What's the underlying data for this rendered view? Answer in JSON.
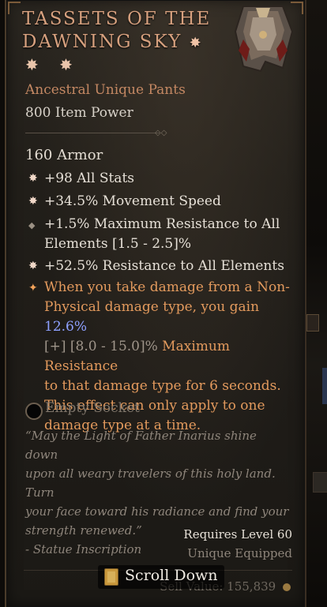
{
  "item": {
    "name": "Tassets of the Dawning Sky",
    "stars": "✸ ✸",
    "title_star": "✸",
    "type": "Ancestral Unique Pants",
    "item_power": "800 Item Power",
    "armor": "160 Armor"
  },
  "affixes": [
    "+98 All Stats",
    "+34.5% Movement Speed",
    "+1.5% Maximum Resistance to All",
    "Elements [1.5 - 2.5]%",
    "+52.5% Resistance to All Elements"
  ],
  "unique_power": {
    "line1": "When you take damage from a Non-",
    "line2a": "Physical damage type, you gain ",
    "line2b": "12.6%",
    "line3a": "[+] [8.0 - 15.0]%",
    "line3b": " Maximum Resistance",
    "line4": "to that damage type for 6 seconds.",
    "line5": "This effect can only apply to one",
    "line6": "damage type at a time."
  },
  "socket": "Empty Socket",
  "flavor": {
    "line1": "“May the Light of Father Inarius shine down",
    "line2": "upon all weary travelers of this holy land. Turn",
    "line3": "your face toward his radiance and find your",
    "line4": "strength renewed.”",
    "line5": "- Statue Inscription"
  },
  "requirements": {
    "level": "Requires Level 60",
    "equipped": "Unique Equipped"
  },
  "sell_value": "Sell Value: 155,839",
  "scroll_label": "Scroll Down",
  "colors": {
    "title": "#d6a07e",
    "unique_text": "#e39a5d",
    "highlight": "#8ea0ff",
    "body": "#e6e0d7"
  },
  "icons": {
    "bullet": "star-icon",
    "socket": "socket-icon",
    "scroll": "scroll-icon",
    "gold": "gold-coin-icon"
  }
}
